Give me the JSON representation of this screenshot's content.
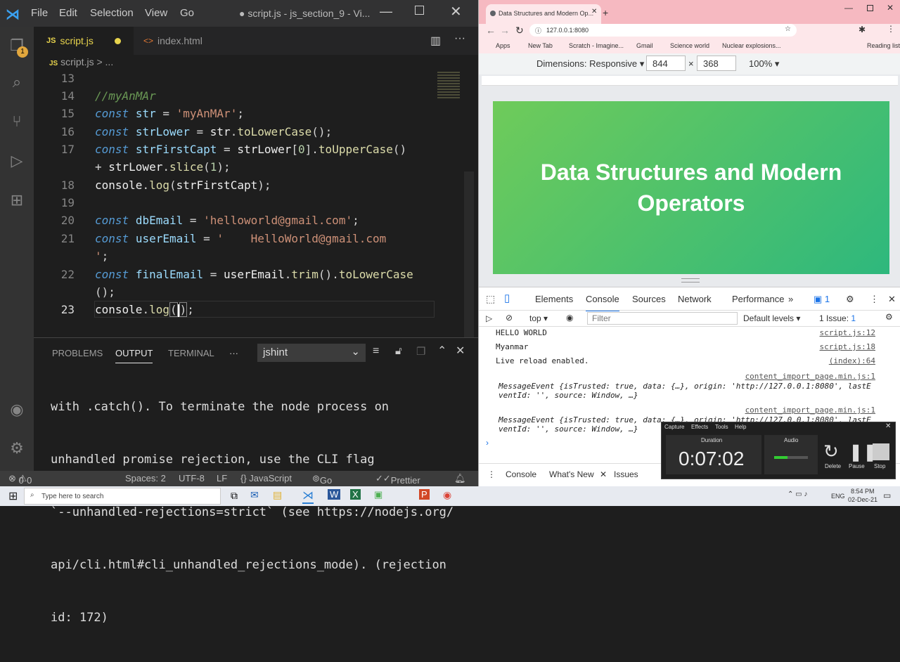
{
  "vscode": {
    "menu": [
      "File",
      "Edit",
      "Selection",
      "View",
      "Go"
    ],
    "window_title": "● script.js - js_section_9 - Vi...",
    "tabs": [
      {
        "label": "script.js",
        "lang": "JS",
        "modified": true
      },
      {
        "label": "index.html",
        "lang": "<>"
      }
    ],
    "breadcrumb": {
      "lang": "JS",
      "file": "script.js",
      "more": "> ..."
    },
    "activity_badge": "1",
    "code_lines": [
      {
        "n": "13"
      },
      {
        "n": "14"
      },
      {
        "n": "15"
      },
      {
        "n": "16"
      },
      {
        "n": "17"
      },
      {
        "n": ""
      },
      {
        "n": "18"
      },
      {
        "n": "19"
      },
      {
        "n": "20"
      },
      {
        "n": "21"
      },
      {
        "n": ""
      },
      {
        "n": "22"
      },
      {
        "n": ""
      },
      {
        "n": "23"
      }
    ],
    "code": {
      "l14": "//myAnMAr",
      "l15_kw": "const",
      "l15_var": "str",
      "l15_str": "'myAnMAr'",
      "l16_kw": "const",
      "l16_var": "strLower",
      "l16_obj": "str",
      "l16_fn": "toLowerCase",
      "l17_kw": "const",
      "l17_var": "strFirstCapt",
      "l17_obj": "strLower",
      "l17_num": "0",
      "l17_fn": "toUpperCase",
      "l17b_obj": "strLower",
      "l17b_fn": "slice",
      "l17b_num": "1",
      "l18_obj": "console",
      "l18_fn": "log",
      "l18_arg": "strFirstCapt",
      "l20_kw": "const",
      "l20_var": "dbEmail",
      "l20_str": "'helloworld@gmail.com'",
      "l21_kw": "const",
      "l21_var": "userEmail",
      "l21_str": "'    HelloWorld@gmail.com",
      "l21b_str": "'",
      "l22_kw": "const",
      "l22_var": "finalEmail",
      "l22_obj": "userEmail",
      "l22_fn1": "trim",
      "l22_fn2": "toLowerCase",
      "l22b": "();",
      "l23_obj": "console",
      "l23_fn": "log"
    },
    "panel": {
      "tabs": [
        "PROBLEMS",
        "OUTPUT",
        "TERMINAL",
        "···"
      ],
      "active_tab": "OUTPUT",
      "channel": "jshint",
      "output_lines": [
        "with .catch(). To terminate the node process on",
        "unhandled promise rejection, use the CLI flag",
        "`--unhandled-rejections=strict` (see https://nodejs.org/",
        "api/cli.html#cli_unhandled_rejections_mode). (rejection",
        "id: 172)"
      ]
    },
    "status": {
      "errors": "0",
      "warnings": "0",
      "spaces": "Spaces: 2",
      "encoding": "UTF-8",
      "eol": "LF",
      "language": "{} JavaScript",
      "golive": "Go Live",
      "prettier": "Prettier"
    }
  },
  "chrome": {
    "tab_title": "Data Structures and Modern Op...",
    "url": "127.0.0.1:8080",
    "bookmarks": [
      "Apps",
      "New Tab",
      "Scratch - Imagine...",
      "Gmail",
      "Science world",
      "Nuclear explosions...",
      "Reading list"
    ],
    "device": {
      "label": "Dimensions: Responsive",
      "width": "844",
      "height": "368",
      "zoom": "100%"
    },
    "hero_text": "Data Structures and Modern Operators",
    "devtools": {
      "tabs": [
        "Elements",
        "Console",
        "Sources",
        "Network",
        "Performance"
      ],
      "active_tab": "Console",
      "msg_count": "1",
      "context": "top",
      "filter_placeholder": "Filter",
      "levels": "Default levels",
      "issues": "1 Issue:",
      "issue_count": "1",
      "logs": [
        {
          "text": "HELLO WORLD",
          "src": "script.js:12"
        },
        {
          "text": "Myanmar",
          "src": "script.js:18"
        },
        {
          "text": "Live reload enabled.",
          "src": "(index):64"
        }
      ],
      "events": [
        {
          "src": "content_import_page.min.js:1",
          "line1": "MessageEvent {isTrusted: true, data: {…}, origin: 'http://127.0.0.1:8080', lastE",
          "line2": "ventId: '', source: Window, …}"
        },
        {
          "src": "content_import_page.min.js:1",
          "line1": "MessageEvent {isTrusted: true, data: {…}, origin: 'http://127.0.0.1:8080', lastE",
          "line2": "ventId: '', source: Window, …}"
        }
      ],
      "drawer_tabs": [
        "Console",
        "What's New",
        "Issues"
      ]
    }
  },
  "recorder": {
    "menu": [
      "Capture",
      "Effects",
      "Tools",
      "Help"
    ],
    "duration_label": "Duration",
    "audio_label": "Audio",
    "time": "0:07:02",
    "buttons": [
      "Delete",
      "Pause",
      "Stop"
    ]
  },
  "taskbar": {
    "search_placeholder": "Type here to search",
    "lang": "ENG",
    "time": "8:54 PM",
    "date": "02-Dec-21"
  }
}
